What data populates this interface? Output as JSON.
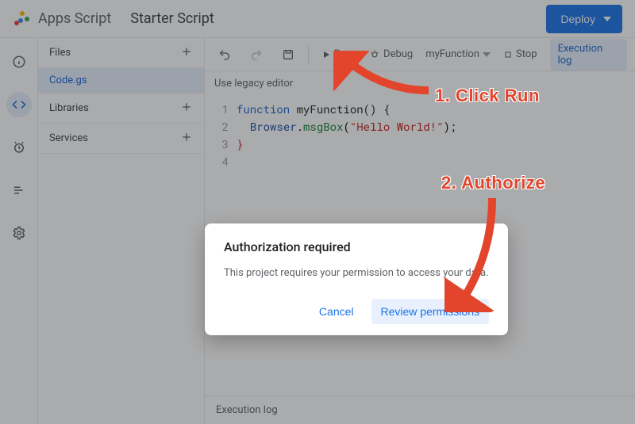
{
  "header": {
    "product_name": "Apps Script",
    "project_name": "Starter Script",
    "deploy_label": "Deploy"
  },
  "rail": {
    "items": [
      "info-icon",
      "editor-icon",
      "triggers-icon",
      "executions-icon",
      "settings-icon"
    ]
  },
  "sidebar": {
    "files_label": "Files",
    "file_name": "Code.gs",
    "libraries_label": "Libraries",
    "services_label": "Services"
  },
  "toolbar": {
    "run_label": "Run",
    "debug_label": "Debug",
    "function_name": "myFunction",
    "stop_label": "Stop",
    "exec_log_label": "Execution log"
  },
  "legacy_link": "Use legacy editor",
  "code": {
    "lines": [
      "1",
      "2",
      "3",
      "4"
    ],
    "l1": {
      "kw": "function ",
      "name": "myFunction",
      "rest": "() {"
    },
    "l2": {
      "indent": "  ",
      "cls": "Browser",
      "dot": ".",
      "meth": "msgBox",
      "open": "(",
      "str": "\"Hello World!\"",
      "close": ");"
    },
    "l3": "}",
    "l4": ""
  },
  "exec_panel": "Execution log",
  "dialog": {
    "title": "Authorization required",
    "body": "This project requires your permission to access your data.",
    "cancel": "Cancel",
    "review": "Review permissions"
  },
  "annotations": {
    "step1": "1. Click Run",
    "step2": "2. Authorize"
  }
}
